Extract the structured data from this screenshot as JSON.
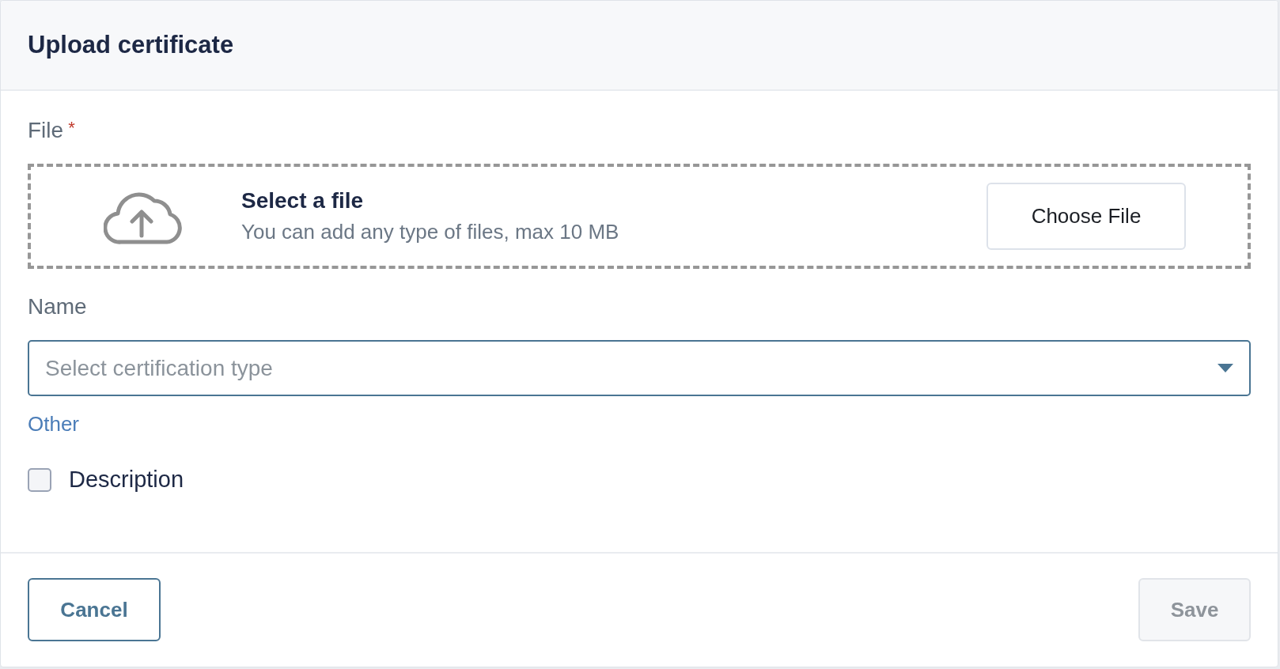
{
  "dialog": {
    "title": "Upload certificate"
  },
  "file_field": {
    "label": "File",
    "required": true,
    "required_mark": "*",
    "dropzone_title": "Select a file",
    "dropzone_hint": "You can add any type of files, max 10 MB",
    "button": "Choose File"
  },
  "name_field": {
    "label": "Name",
    "placeholder": "Select certification type"
  },
  "other_link": "Other",
  "checkbox": {
    "label": "Description",
    "checked": false
  },
  "buttons": [
    {
      "label": "Cancel",
      "kind": "secondary",
      "disabled": false
    },
    {
      "label": "Save",
      "kind": "primary",
      "disabled": true
    }
  ]
}
